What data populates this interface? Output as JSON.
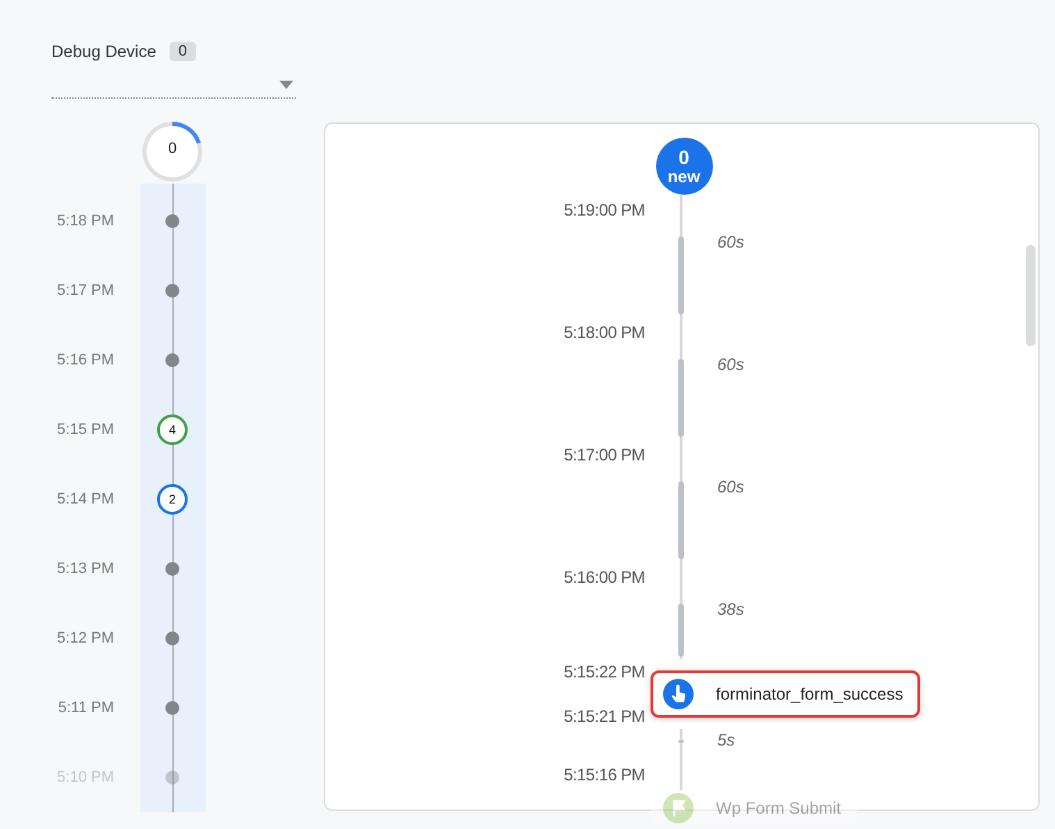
{
  "device": {
    "label": "Debug Device",
    "count": "0"
  },
  "summary": {
    "count": "0",
    "level": 0.2
  },
  "minutes": [
    {
      "time": "5:18 PM",
      "kind": "dot",
      "faded": false
    },
    {
      "time": "5:17 PM",
      "kind": "dot",
      "faded": false
    },
    {
      "time": "5:16 PM",
      "kind": "dot",
      "faded": false
    },
    {
      "time": "5:15 PM",
      "kind": "count",
      "count": "4",
      "color": "#43a047",
      "faded": false
    },
    {
      "time": "5:14 PM",
      "kind": "count",
      "count": "2",
      "color": "#1a73e8",
      "faded": false
    },
    {
      "time": "5:13 PM",
      "kind": "dot",
      "faded": false
    },
    {
      "time": "5:12 PM",
      "kind": "dot",
      "faded": false
    },
    {
      "time": "5:11 PM",
      "kind": "dot",
      "faded": false
    },
    {
      "time": "5:10 PM",
      "kind": "dot",
      "faded": true
    }
  ],
  "stream": {
    "new_count": "0",
    "new_label": "new",
    "rows": [
      {
        "kind": "time",
        "time": "5:19:00 PM"
      },
      {
        "kind": "gap",
        "duration": "60s"
      },
      {
        "kind": "time",
        "time": "5:18:00 PM"
      },
      {
        "kind": "gap",
        "duration": "60s"
      },
      {
        "kind": "time",
        "time": "5:17:00 PM"
      },
      {
        "kind": "gap",
        "duration": "60s"
      },
      {
        "kind": "time",
        "time": "5:16:00 PM"
      },
      {
        "kind": "gap",
        "duration": "38s"
      },
      {
        "kind": "event",
        "name": "forminator_form_success",
        "selected": true,
        "faded": false,
        "times": [
          "5:15:22 PM",
          "5:15:21 PM"
        ]
      },
      {
        "kind": "gap",
        "duration": "5s"
      },
      {
        "kind": "time",
        "time": "5:15:16 PM"
      },
      {
        "kind": "event",
        "name": "Wp Form Submit",
        "selected": false,
        "faded": true,
        "times": []
      }
    ]
  }
}
